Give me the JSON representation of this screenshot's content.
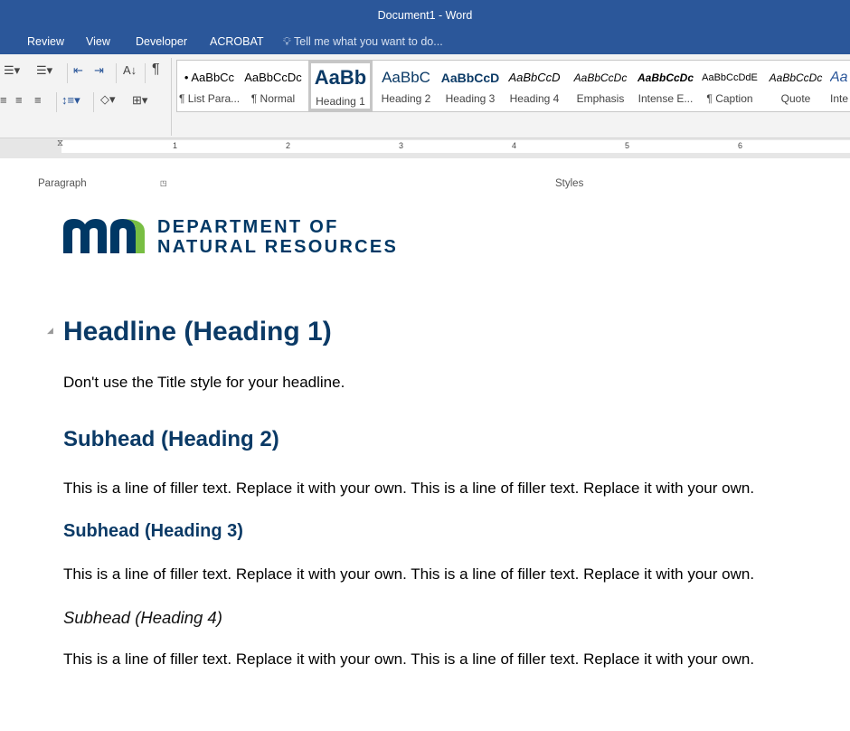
{
  "window": {
    "title": "Document1 - Word"
  },
  "tabs": [
    "Review",
    "View",
    "Developer",
    "ACROBAT"
  ],
  "tell_me": "Tell me what you want to do...",
  "ribbon": {
    "paragraph_label": "Paragraph",
    "styles_label": "Styles"
  },
  "styles": [
    {
      "preview": "• AaBbCc",
      "label": "¶ List Para..."
    },
    {
      "preview": "AaBbCcDc",
      "label": "¶ Normal"
    },
    {
      "preview": "AaBb",
      "label": "Heading 1",
      "selected": true
    },
    {
      "preview": "AaBbC",
      "label": "Heading 2"
    },
    {
      "preview": "AaBbCcD",
      "label": "Heading 3"
    },
    {
      "preview": "AaBbCcD",
      "label": "Heading 4"
    },
    {
      "preview": "AaBbCcDc",
      "label": "Emphasis"
    },
    {
      "preview": "AaBbCcDc",
      "label": "Intense E..."
    },
    {
      "preview": "AaBbCcDdE",
      "label": "¶ Caption"
    },
    {
      "preview": "AaBbCcDc",
      "label": "Quote"
    },
    {
      "preview": "Aa",
      "label": "Inte"
    }
  ],
  "ruler": [
    "1",
    "2",
    "3",
    "4",
    "5",
    "6"
  ],
  "logo": {
    "mark": "mn",
    "line1": "DEPARTMENT OF",
    "line2": "NATURAL RESOURCES",
    "colors": {
      "navy": "#003865",
      "green": "#78be43"
    }
  },
  "document": {
    "h1": "Headline (Heading 1)",
    "p1": "Don't use the Title style for your headline.",
    "h2": "Subhead (Heading 2)",
    "p2": "This is a line of filler text. Replace it with your own. This is a line of filler text. Replace it with your own.",
    "h3": "Subhead (Heading 3)",
    "p3": "This is a line of filler text. Replace it with your own. This is a line of filler text. Replace it with your own.",
    "h4": "Subhead (Heading 4)",
    "p4": "This is a line of filler text. Replace it with your own. This is a line of filler text. Replace it with your own."
  },
  "colors": {
    "titlebar": "#2b579a",
    "heading": "#0b3a66"
  }
}
